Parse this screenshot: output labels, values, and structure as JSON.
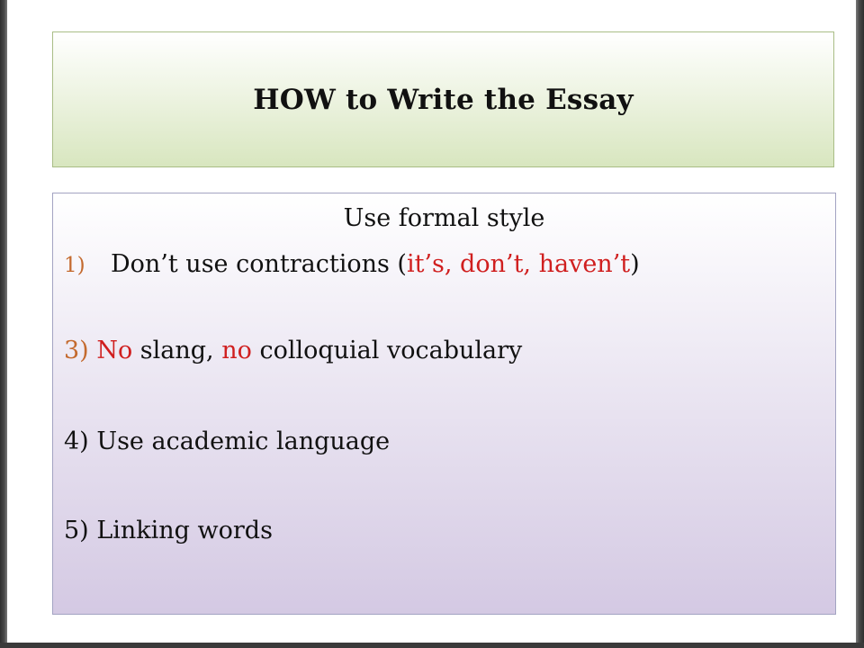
{
  "slide": {
    "title": "HOW to Write the Essay",
    "subtitle": "Use formal style",
    "items": [
      {
        "number": "1)",
        "segments": [
          {
            "text": "Don’t use contractions ("
          },
          {
            "text": "it’s, don’t, haven’t"
          },
          {
            "text": ")"
          }
        ]
      },
      {
        "number": "3)",
        "segments": [
          {
            "text": "No"
          },
          {
            "text": " slang, "
          },
          {
            "text": "no"
          },
          {
            "text": " colloquial vocabulary"
          }
        ]
      },
      {
        "number": "4)",
        "segments": [
          {
            "text": "Use academic language"
          }
        ]
      },
      {
        "number": "5)",
        "segments": [
          {
            "text": "Linking words"
          }
        ]
      }
    ]
  },
  "colors": {
    "number_accent": "#c46a2e",
    "emphasis_red": "#d01f1f",
    "title_box_green": "#d8e6bf",
    "content_box_lavender": "#d4c9e3"
  }
}
